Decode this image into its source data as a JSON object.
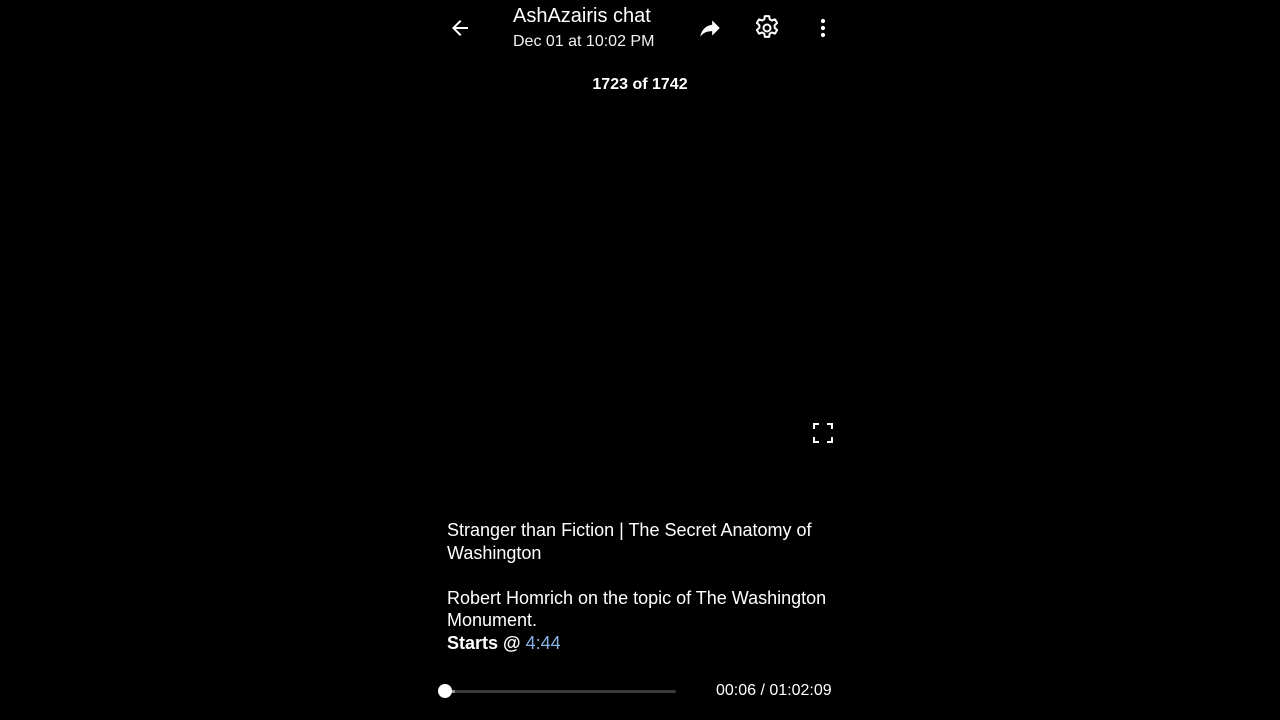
{
  "header": {
    "title": "AshAzairis chat",
    "subtitle": "Dec 01 at 10:02 PM",
    "icons": {
      "back": "arrow-left-icon",
      "share": "share-forward-icon",
      "settings": "gear-icon",
      "more": "more-vertical-icon"
    }
  },
  "media": {
    "counter": "1723 of 1742",
    "fullscreen_icon": "fullscreen-icon"
  },
  "caption": {
    "line1": "Stranger than Fiction | The Secret Anatomy of Washington",
    "line2": "Robert Homrich on the topic of The Washington Monument.",
    "starts_label": "Starts @",
    "starts_link": "4:44",
    "link_color": "#8ab4e8"
  },
  "player": {
    "current_time": "00:06",
    "total_time": "01:02:09",
    "time_display": "00:06 / 01:02:09",
    "progress_fraction": 0.0016
  }
}
